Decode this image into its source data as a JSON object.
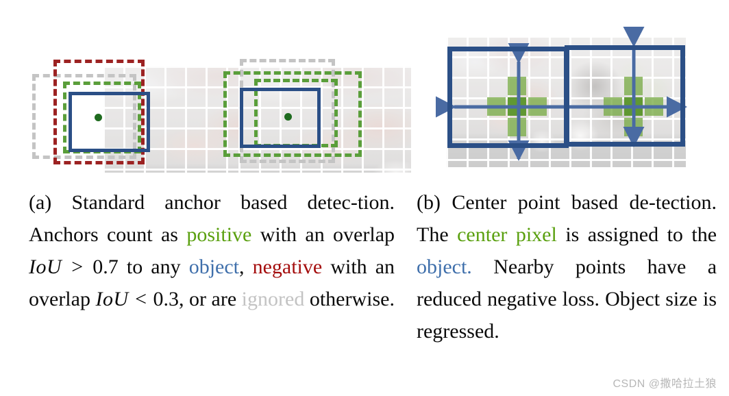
{
  "figure": {
    "subfigures": [
      {
        "id": "a",
        "label": "(a)",
        "caption_lines": [
          "(a) Standard anchor based detec-",
          "tion.   Anchors count as positive",
          "with an overlap IoU > 0.7 to",
          "any object, negative with an over-",
          "lap IoU < 0.3, or are ignored oth-",
          "erwise."
        ],
        "caption_text": "(a) Standard anchor based detection. Anchors count as positive with an overlap IoU > 0.7 to any object, negative with an overlap IoU < 0.3, or are ignored otherwise.",
        "segments": {
          "s1": "(a) Standard anchor based detec-tion.",
          "s2": "Anchors count as",
          "positive": "positive",
          "s3": "with an overlap",
          "iou1": "IoU",
          "gt": ">",
          "v1": "0.7",
          "s4": "to any",
          "object": "object",
          "comma": ", ",
          "negative": "negative",
          "s5": "with an overlap",
          "iou2": "IoU",
          "lt": "<",
          "v2": "0.3",
          "s6": ", or are",
          "ignored": "ignored",
          "s7": "otherwise."
        }
      },
      {
        "id": "b",
        "label": "(b)",
        "caption_lines": [
          "(b) Center point based de-",
          "tection.   The center pixel",
          "is assigned to the object.",
          "Nearby points have a re-",
          "duced negative loss. Object",
          "size is regressed."
        ],
        "caption_text": "(b) Center point based detection. The center pixel is assigned to the object. Nearby points have a reduced negative loss. Object size is regressed.",
        "segments": {
          "s1": "(b) Center point based de-tection.",
          "s2": "The",
          "center_pixel": "center pixel",
          "s3": "is assigned to the",
          "object": "object.",
          "s4": "Nearby points have a reduced negative loss. Object size is regressed."
        }
      }
    ]
  },
  "colors": {
    "positive_green": "#5aa00f",
    "object_blue": "#3f6fab",
    "negative_red": "#a40d0d",
    "ignored_gray": "#c3c3c3",
    "box_blue": "#2b4f86",
    "box_green": "#5a9e3a",
    "box_red": "#9c2222",
    "box_gray": "#c4c4c4",
    "center_dot_green": "#1f6b1f",
    "heatmap_light_green": "#7cad4b",
    "heatmap_dark_green": "#559124"
  },
  "annotations": {
    "panel_a_left": {
      "name": "anchor-example-low-iou",
      "boxes": [
        "gray-dashed-anchor",
        "red-dashed-negative-anchor",
        "green-dashed-ground-truth",
        "blue-solid-anchor"
      ],
      "center_dot": true
    },
    "panel_a_right": {
      "name": "anchor-example-high-iou",
      "boxes": [
        "gray-dashed-anchor",
        "green-dashed-positive-anchor",
        "green-dashed-ground-truth",
        "blue-solid-anchor"
      ],
      "center_dot": true
    },
    "panel_b": {
      "name": "centerpoint-example",
      "boxes": [
        "blue-solid-box-left-cat",
        "blue-solid-box-right-cat"
      ],
      "heatmap_crosses": 2,
      "size_arrows": [
        "width-arrow-left",
        "height-arrow-left",
        "width-arrow-right",
        "height-arrow-right"
      ]
    }
  },
  "watermark": {
    "text": "CSDN @撒哈拉土狼"
  }
}
